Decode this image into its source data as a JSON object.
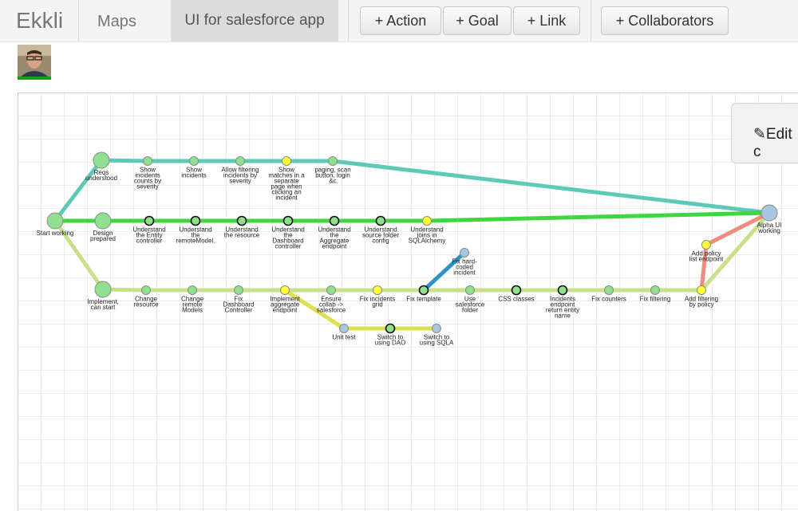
{
  "header": {
    "brand": "Ekkli",
    "nav_maps": "Maps",
    "current_map": "UI for salesforce app",
    "action_label": "+ Action",
    "goal_label": "+ Goal",
    "link_label": "+ Link",
    "collaborators_label": "+ Collaborators"
  },
  "edit_label": "Edit c",
  "colors": {
    "teal": "#5dcab8",
    "green": "#3fd63f",
    "lightgreen": "#c8e08a",
    "yellowline": "#dede4e",
    "blue": "#2a93cc",
    "red": "#ef8c7f",
    "node_green": "#90e090",
    "node_yellow": "#ffff33",
    "node_blue": "#a9c6e0"
  },
  "diagram": {
    "nodes": [
      {
        "id": "start",
        "label": [
          "Start working"
        ],
        "fill": "green",
        "border": "gray",
        "size": "big"
      },
      {
        "id": "reqs",
        "label": [
          "Reqs",
          "understood"
        ],
        "fill": "green",
        "border": "gray",
        "size": "big"
      },
      {
        "id": "design",
        "label": [
          "Design",
          "prepared"
        ],
        "fill": "green",
        "border": "gray",
        "size": "big"
      },
      {
        "id": "impl",
        "label": [
          "Implement,",
          "can start"
        ],
        "fill": "green",
        "border": "gray",
        "size": "big"
      },
      {
        "id": "alpha",
        "label": [
          "Alpha UI",
          "working"
        ],
        "fill": "blue",
        "border": "gray",
        "size": "big"
      },
      {
        "id": "t1",
        "label": [
          "Show",
          "incidents",
          "counts by",
          "severity"
        ],
        "fill": "green",
        "border": "gray",
        "size": "small"
      },
      {
        "id": "t2",
        "label": [
          "Show",
          "incidents"
        ],
        "fill": "green",
        "border": "gray",
        "size": "small"
      },
      {
        "id": "t3",
        "label": [
          "Allow filtering",
          "incidents by",
          "severity"
        ],
        "fill": "green",
        "border": "gray",
        "size": "small"
      },
      {
        "id": "t4",
        "label": [
          "Show",
          "matches in a",
          "separate",
          "page when",
          "clicking an",
          "incident"
        ],
        "fill": "yellow",
        "border": "gray",
        "size": "small"
      },
      {
        "id": "t5",
        "label": [
          "paging, scan",
          "button, login",
          "&c"
        ],
        "fill": "green",
        "border": "gray",
        "size": "small"
      },
      {
        "id": "m1",
        "label": [
          "Understand",
          "the Entity",
          "controller"
        ],
        "fill": "green",
        "border": "black",
        "size": "small"
      },
      {
        "id": "m2",
        "label": [
          "Understand",
          "the",
          "remoteModel."
        ],
        "fill": "green",
        "border": "black",
        "size": "small"
      },
      {
        "id": "m3",
        "label": [
          "Understand",
          "the resource"
        ],
        "fill": "green",
        "border": "black",
        "size": "small"
      },
      {
        "id": "m4",
        "label": [
          "Understand",
          "the",
          "Dashboard",
          "controller"
        ],
        "fill": "green",
        "border": "black",
        "size": "small"
      },
      {
        "id": "m5",
        "label": [
          "Understand",
          "the",
          "Aggregate",
          "endpoint"
        ],
        "fill": "green",
        "border": "black",
        "size": "small"
      },
      {
        "id": "m6",
        "label": [
          "Understand",
          "source folder",
          "config"
        ],
        "fill": "green",
        "border": "black",
        "size": "small"
      },
      {
        "id": "m7",
        "label": [
          "Understand",
          "joins in",
          "SQLAlchemy"
        ],
        "fill": "yellow",
        "border": "gray",
        "size": "small"
      },
      {
        "id": "b1",
        "label": [
          "Change",
          "resource"
        ],
        "fill": "green",
        "border": "gray",
        "size": "small"
      },
      {
        "id": "b2",
        "label": [
          "Change",
          "remote",
          "Models"
        ],
        "fill": "green",
        "border": "gray",
        "size": "small"
      },
      {
        "id": "b3",
        "label": [
          "Fix",
          "Dashboard",
          "Controller"
        ],
        "fill": "green",
        "border": "gray",
        "size": "small"
      },
      {
        "id": "b4",
        "label": [
          "Implement",
          "aggregate",
          "endpoint"
        ],
        "fill": "yellow",
        "border": "gray",
        "size": "small"
      },
      {
        "id": "b5",
        "label": [
          "Ensure",
          "collab ->",
          "salesforce"
        ],
        "fill": "green",
        "border": "gray",
        "size": "small"
      },
      {
        "id": "b6",
        "label": [
          "Fix incidents",
          "grid"
        ],
        "fill": "yellow",
        "border": "gray",
        "size": "small"
      },
      {
        "id": "b7",
        "label": [
          "Fix template"
        ],
        "fill": "green",
        "border": "black",
        "size": "small"
      },
      {
        "id": "b8",
        "label": [
          "Use",
          "salesforce",
          "folder"
        ],
        "fill": "green",
        "border": "gray",
        "size": "small"
      },
      {
        "id": "b9",
        "label": [
          "CSS classes"
        ],
        "fill": "green",
        "border": "black",
        "size": "small"
      },
      {
        "id": "b10",
        "label": [
          "Incidents",
          "endpoint",
          "return entity",
          "name"
        ],
        "fill": "green",
        "border": "black",
        "size": "small"
      },
      {
        "id": "b11",
        "label": [
          "Fix counters"
        ],
        "fill": "green",
        "border": "gray",
        "size": "small"
      },
      {
        "id": "b12",
        "label": [
          "Fix filtering"
        ],
        "fill": "green",
        "border": "gray",
        "size": "small"
      },
      {
        "id": "b13",
        "label": [
          "Add filtering",
          "by policy"
        ],
        "fill": "yellow",
        "border": "gray",
        "size": "small"
      },
      {
        "id": "hc",
        "label": [
          "Fix hard-",
          "coded",
          "incident"
        ],
        "fill": "blue",
        "border": "gray",
        "size": "small"
      },
      {
        "id": "ap",
        "label": [
          "Add policy",
          "list endpoint"
        ],
        "fill": "yellow",
        "border": "gray",
        "size": "small"
      },
      {
        "id": "u1",
        "label": [
          "Unit test"
        ],
        "fill": "blue",
        "border": "gray",
        "size": "small"
      },
      {
        "id": "u2",
        "label": [
          "Switch to",
          "using DAO"
        ],
        "fill": "green",
        "border": "black",
        "size": "small"
      },
      {
        "id": "u3",
        "label": [
          "Switch to",
          "using SQLA"
        ],
        "fill": "blue",
        "border": "gray",
        "size": "small"
      }
    ],
    "edges": [
      {
        "path": [
          "start",
          "reqs",
          "t1",
          "t2",
          "t3",
          "t4",
          "t5",
          "alpha"
        ],
        "color": "teal"
      },
      {
        "path": [
          "start",
          "design",
          "m1",
          "m2",
          "m3",
          "m4",
          "m5",
          "m6",
          "m7",
          "alpha"
        ],
        "color": "green"
      },
      {
        "path": [
          "start",
          "impl",
          "b1",
          "b2",
          "b3",
          "b4",
          "b5",
          "b6",
          "b7",
          "b8",
          "b9",
          "b10",
          "b11",
          "b12",
          "b13",
          "alpha"
        ],
        "color": "lightgreen"
      },
      {
        "path": [
          "b4",
          "u1",
          "u2",
          "u3"
        ],
        "color": "yellowline"
      },
      {
        "path": [
          "b7",
          "hc"
        ],
        "color": "blue"
      },
      {
        "path": [
          "b13",
          "ap",
          "alpha"
        ],
        "color": "red"
      }
    ]
  }
}
